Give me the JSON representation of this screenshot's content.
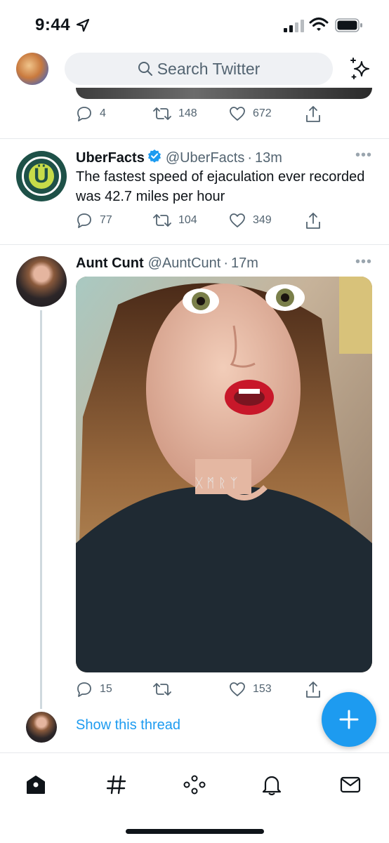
{
  "status": {
    "time": "9:44"
  },
  "header": {
    "search_placeholder": "Search Twitter"
  },
  "tweets": [
    {
      "reply_count": "4",
      "retweet_count": "148",
      "like_count": "672"
    },
    {
      "name": "UberFacts",
      "handle": "@UberFacts",
      "time": "13m",
      "text": "The fastest speed of ejaculation ever recorded was 42.7 miles per hour",
      "reply_count": "77",
      "retweet_count": "104",
      "like_count": "349",
      "verified": true
    },
    {
      "name": "Aunt Cunt",
      "handle": "@AuntCunt",
      "time": "17m",
      "reply_count": "15",
      "retweet_count": "",
      "like_count": "153",
      "show_thread": "Show this thread"
    }
  ],
  "tabs": [
    "home-icon",
    "explore-hashtag-icon",
    "spaces-icon",
    "notifications-bell-icon",
    "messages-mail-icon"
  ],
  "colors": {
    "accent": "#1d9bf0",
    "text": "#0f1419",
    "muted": "#536471",
    "uberfacts_green": "#1e5148",
    "uberfacts_lime": "#c7dc49"
  }
}
